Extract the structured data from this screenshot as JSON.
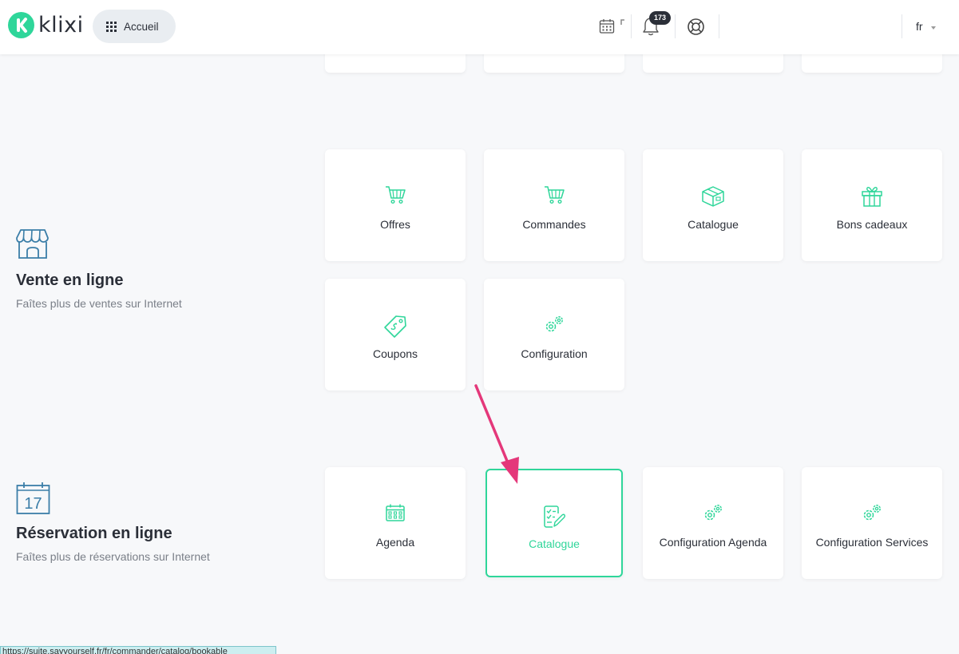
{
  "header": {
    "brand": "klixi",
    "home_label": "Accueil",
    "notification_count": "173",
    "language": "fr"
  },
  "sections": {
    "vente": {
      "title": "Vente en ligne",
      "subtitle": "Faîtes plus de ventes sur Internet"
    },
    "reservation": {
      "title": "Réservation en ligne",
      "subtitle": "Faîtes plus de réservations sur Internet"
    }
  },
  "cards": {
    "offres": "Offres",
    "commandes": "Commandes",
    "catalogue_vente": "Catalogue",
    "bons_cadeaux": "Bons cadeaux",
    "coupons": "Coupons",
    "configuration": "Configuration",
    "agenda": "Agenda",
    "catalogue_reservation": "Catalogue",
    "configuration_agenda": "Configuration Agenda",
    "configuration_services": "Configuration Services"
  },
  "calendar_day": "17",
  "status_url": "https://suite.sayyourself.fr/fr/commander/catalog/bookable",
  "colors": {
    "accent": "#2fd69a",
    "icon_blue": "#3b7ea8",
    "arrow": "#e4387a"
  }
}
